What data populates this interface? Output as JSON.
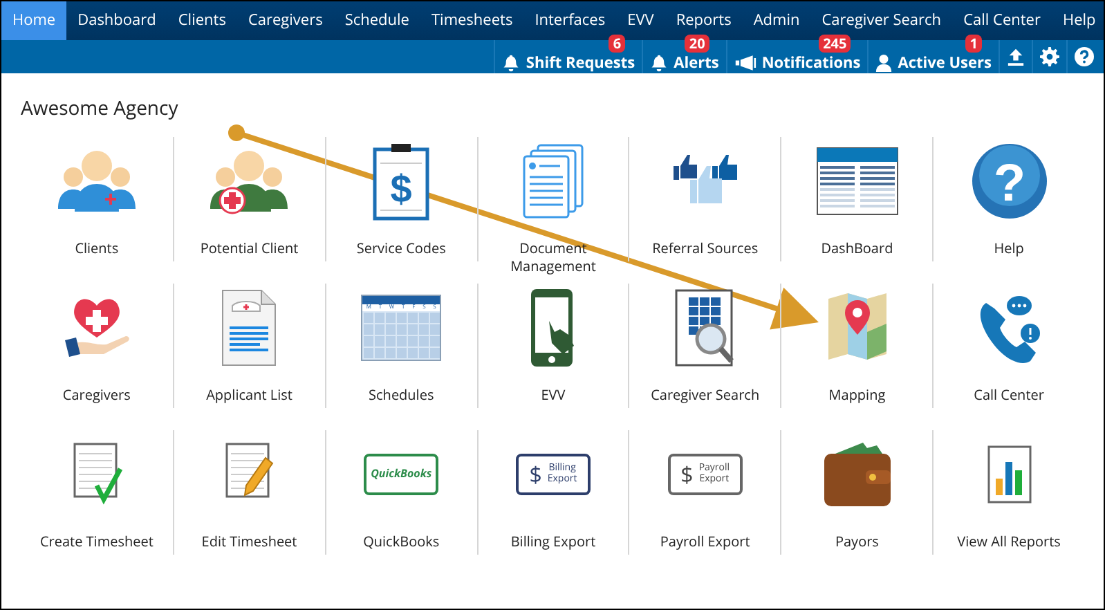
{
  "nav": [
    {
      "label": "Home",
      "selected": true
    },
    {
      "label": "Dashboard",
      "selected": false
    },
    {
      "label": "Clients",
      "selected": false
    },
    {
      "label": "Caregivers",
      "selected": false
    },
    {
      "label": "Schedule",
      "selected": false
    },
    {
      "label": "Timesheets",
      "selected": false
    },
    {
      "label": "Interfaces",
      "selected": false
    },
    {
      "label": "EVV",
      "selected": false
    },
    {
      "label": "Reports",
      "selected": false
    },
    {
      "label": "Admin",
      "selected": false
    },
    {
      "label": "Caregiver Search",
      "selected": false
    },
    {
      "label": "Call Center",
      "selected": false
    },
    {
      "label": "Help",
      "selected": false
    }
  ],
  "toolbar": [
    {
      "kind": "bell",
      "label": "Shift Requests",
      "badge": "6"
    },
    {
      "kind": "bell",
      "label": "Alerts",
      "badge": "20"
    },
    {
      "kind": "megaphone",
      "label": "Notifications",
      "badge": "245"
    },
    {
      "kind": "user",
      "label": "Active Users",
      "badge": "1"
    }
  ],
  "toolbar_icons": [
    {
      "kind": "upload"
    },
    {
      "kind": "settings"
    },
    {
      "kind": "help"
    }
  ],
  "title": "Awesome Agency",
  "tiles": [
    {
      "kind": "people",
      "label": "Clients"
    },
    {
      "kind": "people-cross",
      "label": "Potential Client"
    },
    {
      "kind": "clipboard-dollar",
      "label": "Service Codes",
      "icon_text": [
        "$"
      ]
    },
    {
      "kind": "documents",
      "label": "Document Management"
    },
    {
      "kind": "thumbs",
      "label": "Referral Sources"
    },
    {
      "kind": "table",
      "label": "DashBoard"
    },
    {
      "kind": "question",
      "label": "Help",
      "icon_text": [
        "?"
      ]
    },
    {
      "kind": "heart-hand",
      "label": "Caregivers"
    },
    {
      "kind": "application",
      "label": "Applicant List"
    },
    {
      "kind": "calendar",
      "label": "Schedules",
      "icon_text": [
        "M",
        "T",
        "W",
        "T",
        "F",
        "S",
        "S"
      ]
    },
    {
      "kind": "phone",
      "label": "EVV"
    },
    {
      "kind": "magnifier",
      "label": "Caregiver Search"
    },
    {
      "kind": "map",
      "label": "Mapping"
    },
    {
      "kind": "call",
      "label": "Call Center"
    },
    {
      "kind": "check-sheet",
      "label": "Create Timesheet"
    },
    {
      "kind": "pencil-sheet",
      "label": "Edit Timesheet"
    },
    {
      "kind": "qb",
      "label": "QuickBooks",
      "icon_text": [
        "QuickBooks"
      ]
    },
    {
      "kind": "export-navy",
      "label": "Billing Export",
      "icon_text": [
        "$",
        "Billing",
        "Export"
      ]
    },
    {
      "kind": "export-grey",
      "label": "Payroll Export",
      "icon_text": [
        "$",
        "Payroll",
        "Export"
      ]
    },
    {
      "kind": "wallet",
      "label": "Payors"
    },
    {
      "kind": "report",
      "label": "View All Reports"
    }
  ]
}
